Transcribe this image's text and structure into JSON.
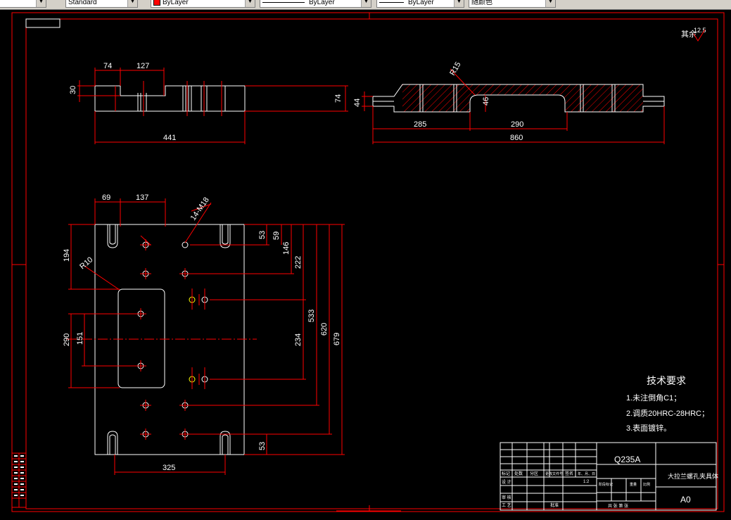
{
  "toolbar": {
    "text_style": "Standard",
    "color": "ByLayer",
    "linetype": "ByLayer",
    "lineweight": "ByLayer",
    "plot_style": "随颜色"
  },
  "drawing": {
    "roughness_label": "其余",
    "roughness_value": "12.5",
    "top_view_dims": [
      "74",
      "127",
      "30",
      "441"
    ],
    "front_view_dims": [
      "R15",
      "74",
      "44",
      "46",
      "285",
      "290",
      "860"
    ],
    "plan_view_dims": [
      "69",
      "137",
      "14-M18",
      "194",
      "R10",
      "53",
      "59",
      "146",
      "222",
      "533",
      "620",
      "679",
      "290",
      "151",
      "234",
      "53",
      "325"
    ],
    "tech_title": "技术要求",
    "tech_notes": [
      "1.未注倒角C1；",
      "2.调质20HRC-28HRC；",
      "3.表面镀锌。"
    ],
    "title_block": {
      "material": "Q235A",
      "part_name": "大拉兰螺孔夹具体",
      "sheet_size": "A0",
      "scale": "1:2",
      "row_labels": [
        "标记",
        "处数",
        "分区",
        "更改文件号",
        "签名",
        "年、月、日"
      ],
      "design": "设 计",
      "process": "工 艺",
      "review": "审 核",
      "stage_label": "阶段标记",
      "weight_label": "重量",
      "ratio_label": "比例",
      "sheets": "共  张  第  张",
      "approve": "批准"
    }
  },
  "colors": {
    "line": "#ffffff",
    "dim": "#ff0000",
    "hole": "#ffff00",
    "toolbar": "#d4d0c8"
  }
}
